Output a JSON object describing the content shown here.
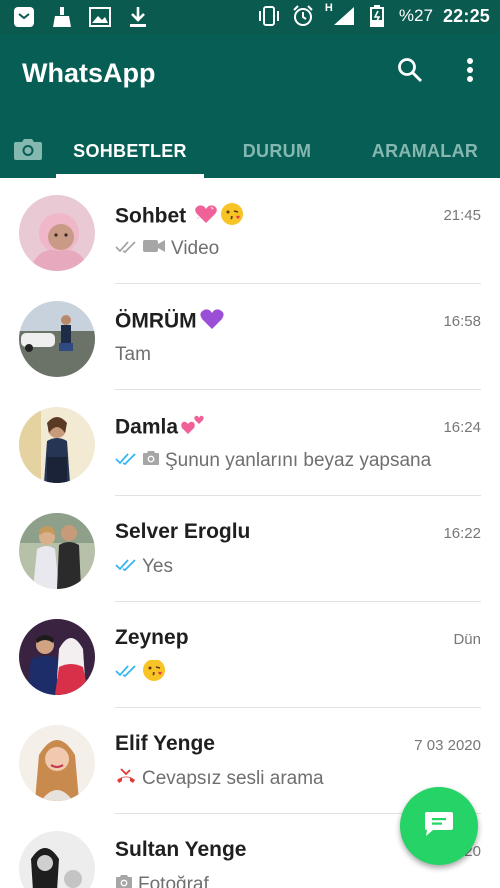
{
  "status_bar": {
    "left_icons": [
      "notification-app-icon",
      "broom-icon",
      "image-icon",
      "download-icon"
    ],
    "right_icons": [
      "vibrate-icon",
      "alarm-icon",
      "signal-icon",
      "battery-icon"
    ],
    "network_type": "H",
    "battery": "%27",
    "time": "22:25"
  },
  "header": {
    "title": "WhatsApp",
    "search_icon": "search-icon",
    "more_icon": "more-vert-icon"
  },
  "tabs": {
    "camera_icon": "camera-icon",
    "chats": "SOHBETLER",
    "status": "DURUM",
    "calls": "ARAMALAR",
    "active": "SOHBETLER"
  },
  "colors": {
    "status_bar": "#0b5a4f",
    "app_bar": "#075e54",
    "read_tick": "#34b7f1",
    "missed_call": "#e53935",
    "fab": "#25d366"
  },
  "chats": [
    {
      "name": "Sohbet",
      "name_emoji": [
        "sparkling-heart",
        "kiss-face"
      ],
      "time": "21:45",
      "ticks": "delivered",
      "media_icon": "video-icon",
      "preview": "Video"
    },
    {
      "name": "ÖMRÜM",
      "name_emoji": [
        "purple-heart"
      ],
      "time": "16:58",
      "ticks": "",
      "media_icon": "",
      "preview": "Tam"
    },
    {
      "name": "Damla",
      "name_emoji": [
        "two-hearts"
      ],
      "time": "16:24",
      "ticks": "read",
      "media_icon": "camera-icon",
      "preview": "Şunun yanlarını beyaz yapsana"
    },
    {
      "name": "Selver Eroglu",
      "name_emoji": [],
      "time": "16:22",
      "ticks": "read",
      "media_icon": "",
      "preview": "Yes"
    },
    {
      "name": "Zeynep",
      "name_emoji": [],
      "time": "Dün",
      "ticks": "read",
      "media_icon": "",
      "preview": "",
      "preview_emoji": [
        "kiss-face"
      ]
    },
    {
      "name": "Elif Yenge",
      "name_emoji": [],
      "time": "7 03 2020",
      "ticks": "",
      "media_icon": "missed-call-icon",
      "preview": "Cevapsız sesli arama"
    },
    {
      "name": "Sultan Yenge",
      "name_emoji": [],
      "time": "3 03 2020",
      "ticks": "",
      "media_icon": "camera-icon",
      "preview": "Fotoğraf"
    }
  ],
  "fab": {
    "icon": "new-chat-icon"
  }
}
